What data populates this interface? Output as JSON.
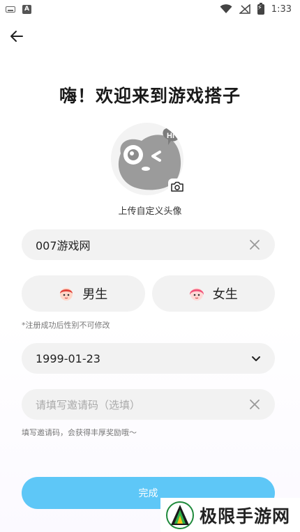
{
  "status_bar": {
    "time": "1:33"
  },
  "header": {
    "title": "嗨！欢迎来到游戏搭子"
  },
  "avatar": {
    "caption": "上传自定义头像"
  },
  "nickname": {
    "value": "007游戏网"
  },
  "gender": {
    "male_label": "男生",
    "female_label": "女生",
    "hint": "*注册成功后性别不可修改"
  },
  "birthday": {
    "value": "1999-01-23"
  },
  "invite": {
    "placeholder": "请填写邀请码（选填）",
    "hint": "填写邀请码，会获得丰厚奖励哦～"
  },
  "actions": {
    "submit_label": "完成"
  },
  "watermark": {
    "text": "极限手游网"
  },
  "colors": {
    "accent": "#5ec7f7",
    "field_bg": "#f2f2f2"
  }
}
